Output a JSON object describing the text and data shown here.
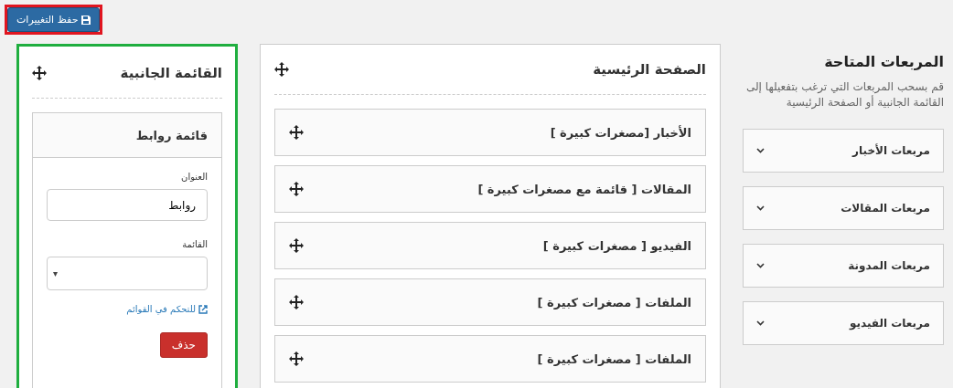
{
  "save_button": {
    "label": "حفظ التغييرات",
    "highlighted": true
  },
  "available": {
    "title": "المربعات المتاحة",
    "description": "قم بسحب المربعات التي ترغب بتفعيلها إلى القائمة الجانبية أو الصفحة الرئيسية",
    "items": [
      {
        "label": "مربعات الأخبار",
        "expanded": false
      },
      {
        "label": "مربعات المقالات",
        "expanded": false
      },
      {
        "label": "مربعات المدونة",
        "expanded": false
      },
      {
        "label": "مربعات الفيديو",
        "expanded": false
      }
    ]
  },
  "home": {
    "title": "الصفحة الرئيسية",
    "items": [
      "الأخبار [مصغرات كبيرة ]",
      "المقالات [ قائمة مع مصغرات كبيرة ]",
      "الفيديو [ مصغرات كبيرة ]",
      "الملفات [ مصغرات كبيرة ]",
      "الملفات [ مصغرات كبيرة ]"
    ]
  },
  "sidebar": {
    "title": "القائمة الجانبية",
    "highlighted": true,
    "widget": {
      "title": "قائمة روابط",
      "title_label": "العنوان",
      "title_value": "روابط",
      "list_label": "القائمة",
      "list_value_arrow": "▾",
      "manage_link": "للتحكم في القوائم",
      "delete_button": "حذف"
    }
  }
}
